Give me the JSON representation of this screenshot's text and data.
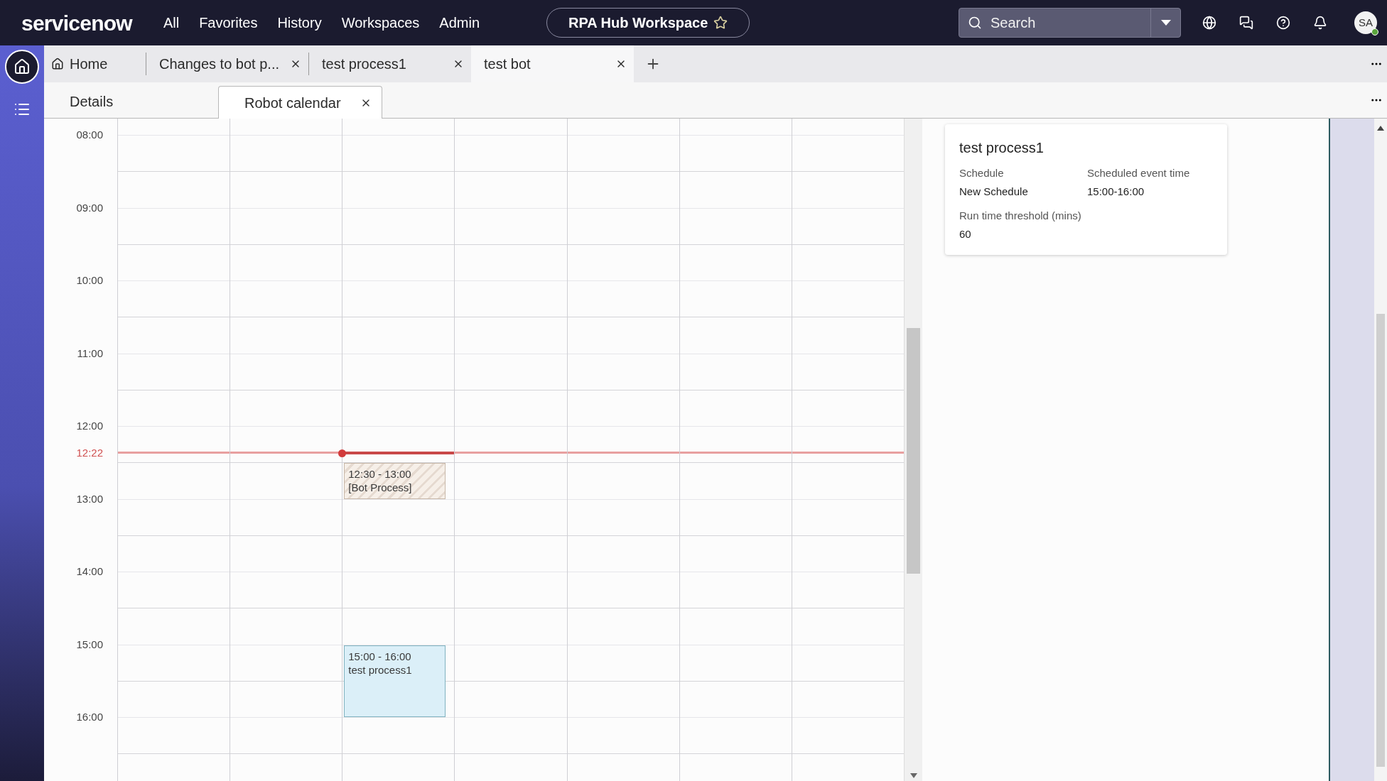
{
  "top_nav": {
    "logo": "servicenow",
    "links": [
      "All",
      "Favorites",
      "History",
      "Workspaces",
      "Admin"
    ],
    "workspace": "RPA Hub Workspace",
    "search": {
      "placeholder": "Search"
    },
    "avatar": "SA"
  },
  "tabs": [
    {
      "label": "Home",
      "kind": "home",
      "selected": false
    },
    {
      "label": "Changes to bot p...",
      "kind": "record",
      "selected": false
    },
    {
      "label": "test process1",
      "kind": "record",
      "selected": false
    },
    {
      "label": "test bot",
      "kind": "record",
      "selected": true
    }
  ],
  "subtabs": [
    {
      "label": "Details",
      "selected": false,
      "closable": false
    },
    {
      "label": "Robot calendar",
      "selected": true,
      "closable": true
    }
  ],
  "calendar": {
    "hours": [
      "08:00",
      "09:00",
      "10:00",
      "11:00",
      "12:00",
      "13:00",
      "14:00",
      "15:00",
      "16:00"
    ],
    "now": "12:22",
    "columns": [
      {
        "today": false
      },
      {
        "today": false
      },
      {
        "today": true,
        "events": [
          {
            "time": "12:30 - 13:00",
            "title": "[Bot Process]",
            "kind": "bot"
          },
          {
            "time": "15:00 - 16:00",
            "title": "test process1",
            "kind": "process"
          }
        ]
      },
      {
        "today": false
      },
      {
        "today": false
      },
      {
        "today": false
      },
      {
        "today": false
      }
    ]
  },
  "detail_card": {
    "title": "test process1",
    "fields": [
      {
        "label": "Schedule",
        "value": "New Schedule"
      },
      {
        "label": "Scheduled event time",
        "value": "15:00-16:00"
      },
      {
        "label": "Run time threshold (mins)",
        "value": "60"
      }
    ]
  }
}
